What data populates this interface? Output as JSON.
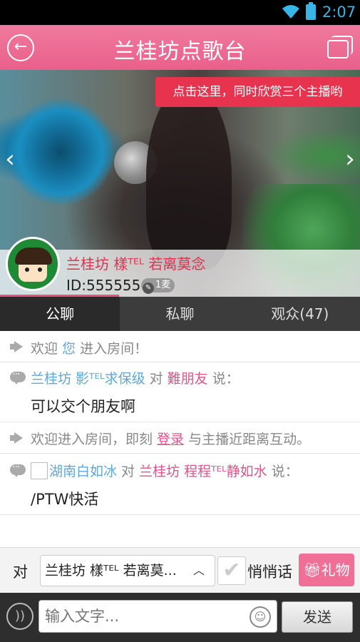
{
  "status_bar": {
    "time": "2:07",
    "icons": [
      "wifi-icon",
      "battery-icon"
    ]
  },
  "header": {
    "title": "兰桂坊点歌台",
    "back_icon": "back-arrow-icon",
    "multi_icon": "multi-window-icon"
  },
  "video": {
    "promo": "点击这里，同时欣赏三个主播哟",
    "prev_icon": "chevron-left-icon",
    "next_icon": "chevron-right-icon"
  },
  "host": {
    "name": "兰桂坊 樣ᵀᴱᴸ 若离莫念",
    "id": "ID:555555",
    "badge": "1麦",
    "progress": 0.33
  },
  "tabs": [
    {
      "label": "公聊",
      "active": true
    },
    {
      "label": "私聊",
      "active": false
    },
    {
      "label": "观众(47)",
      "active": false
    }
  ],
  "messages": [
    {
      "type": "system",
      "pre": "欢迎 ",
      "user": "您",
      "post": " 进入房间！"
    },
    {
      "type": "chat",
      "from": "兰桂坊 影ᵀᴱᴸ求保级",
      "mid": " 对 ",
      "to": "難朋友",
      "says": " 说：",
      "text": "可以交个朋友啊"
    },
    {
      "type": "system",
      "pre": "欢迎进入房间，即刻 ",
      "link": "登录",
      "post": " 与主播近距离互动。"
    },
    {
      "type": "chat",
      "from": "湖南白如冰",
      "mid": " 对 ",
      "to": "兰桂坊 程程ᵀᴱᴸ静如水",
      "says": " 说：",
      "text": "/PTW快活"
    }
  ],
  "target": {
    "to_label": "对",
    "recipient": "兰桂坊 樣ᵀᴱᴸ 若离莫...",
    "whisper": "悄悄话",
    "gift": "礼物"
  },
  "input": {
    "placeholder": "输入文字...",
    "send": "发送"
  },
  "colors": {
    "header": "#e9608b",
    "accent": "#e2528b",
    "user_blue": "#5ba9dc",
    "promo": "#e8334f"
  }
}
